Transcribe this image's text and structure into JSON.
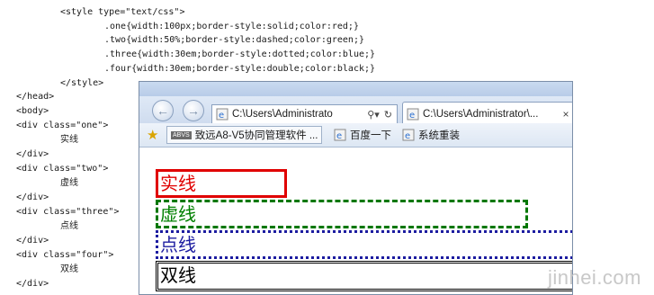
{
  "code": {
    "lines": [
      "<style type=\"text/css\">",
      ".one{width:100px;border-style:solid;color:red;}",
      ".two{width:50%;border-style:dashed;color:green;}",
      ".three{width:30em;border-style:dotted;color:blue;}",
      ".four{width:30em;border-style:double;color:black;}",
      "</style>",
      "</head>",
      "<body>",
      "<div class=\"one\">",
      "实线",
      "</div>",
      "<div class=\"two\">",
      "虚线",
      "</div>",
      "<div class=\"three\">",
      "点线",
      "</div>",
      "<div class=\"four\">",
      "双线",
      "</div>"
    ]
  },
  "browser": {
    "address": "C:\\Users\\Administrato",
    "tab_title": "C:\\Users\\Administrator\\...",
    "favorites": [
      {
        "badge": "ABVS",
        "label": "致远A8-V5协同管理软件 ..."
      },
      {
        "label": "百度一下"
      },
      {
        "label": "系统重装"
      }
    ],
    "boxes": {
      "one": "实线",
      "two": "虚线",
      "three": "点线",
      "four": "双线"
    },
    "colors": {
      "one": "#e00000",
      "two": "#008000",
      "three": "#1c1ca0",
      "four": "#000000"
    }
  },
  "watermark": "jinhei.com"
}
